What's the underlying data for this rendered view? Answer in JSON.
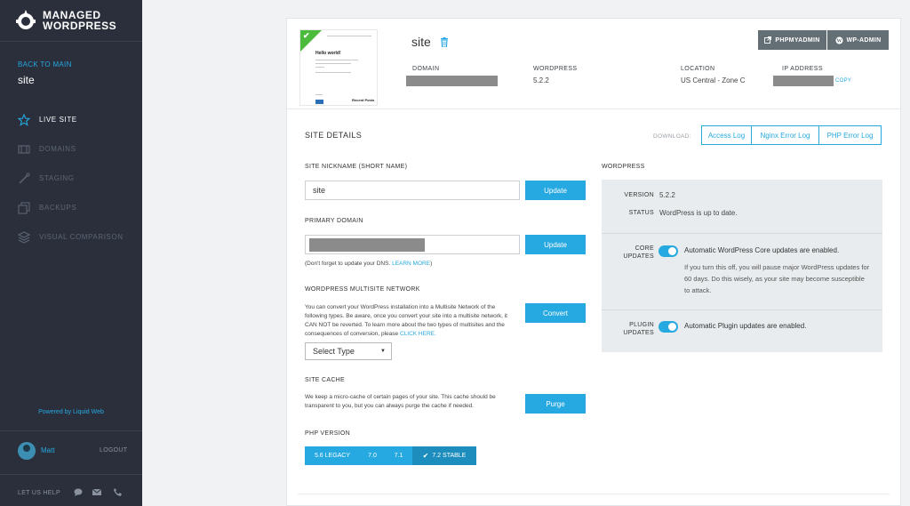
{
  "sidebar": {
    "brand_line1": "MANAGED",
    "brand_line2": "WORDPRESS",
    "back_label": "BACK TO MAIN",
    "site_name": "site",
    "items": [
      {
        "label": "LIVE SITE",
        "icon": "star-icon",
        "active": true
      },
      {
        "label": "DOMAINS",
        "icon": "domains-icon",
        "active": false
      },
      {
        "label": "STAGING",
        "icon": "staging-icon",
        "active": false
      },
      {
        "label": "BACKUPS",
        "icon": "backups-icon",
        "active": false
      },
      {
        "label": "VISUAL COMPARISON",
        "icon": "layers-icon",
        "active": false
      }
    ],
    "powered": "Powered by Liquid Web",
    "user": "Matt",
    "logout": "LOGOUT",
    "help": "LET US HELP"
  },
  "thumb": {
    "title": "Hello world!",
    "posts": "Recent Posts"
  },
  "header": {
    "site_title": "site",
    "domain_label": "DOMAIN",
    "wp_label": "WORDPRESS",
    "wp_version": "5.2.2",
    "location_label": "LOCATION",
    "location_value": "US Central - Zone C",
    "ip_label": "IP ADDRESS",
    "copy": "COPY",
    "phpmyadmin": "PHPMYADMIN",
    "wpadmin": "WP-ADMIN"
  },
  "details": {
    "title": "SITE DETAILS",
    "download_label": "DOWNLOAD:",
    "logs": [
      "Access Log",
      "Nginx Error Log",
      "PHP Error Log"
    ],
    "nickname_label": "SITE NICKNAME (SHORT NAME)",
    "nickname_value": "site",
    "update": "Update",
    "primary_domain_label": "PRIMARY DOMAIN",
    "dns_hint_pre": "(Don't forget to update your DNS.",
    "dns_hint_link": "LEARN MORE",
    "dns_hint_post": ")",
    "multisite_label": "WORDPRESS MULTISITE NETWORK",
    "multisite_text": "You can convert your WordPress installation into a Multisite Network of the following types. Be aware, once you convert your site into a multisite network, it CAN NOT be reverted. To learn more about the two types of multisites and the consequences of conversion, please",
    "multisite_link": "CLICK HERE.",
    "convert": "Convert",
    "select_value": "Select Type",
    "cache_label": "SITE CACHE",
    "cache_text": "We keep a micro-cache of certain pages of your site. This cache should be transparent to you, but you can always purge the cache if needed.",
    "purge": "Purge",
    "php_label": "PHP VERSION",
    "php_versions": [
      {
        "label": "5.6 LEGACY",
        "active": false
      },
      {
        "label": "7.0",
        "active": false
      },
      {
        "label": "7.1",
        "active": false
      },
      {
        "label": "7.2 STABLE",
        "active": true
      }
    ]
  },
  "wordpress": {
    "title": "WORDPRESS",
    "version_label": "VERSION",
    "version_value": "5.2.2",
    "status_label": "STATUS",
    "status_value": "WordPress is up to date.",
    "core_label_1": "CORE",
    "core_label_2": "UPDATES",
    "core_on": true,
    "core_text": "Automatic WordPress Core updates are enabled.",
    "core_note": "If you turn this off, you will pause major WordPress updates for 60 days. Do this wisely, as your site may become susceptible to attack.",
    "plugin_label_1": "PLUGIN",
    "plugin_label_2": "UPDATES",
    "plugin_on": true,
    "plugin_text": "Automatic Plugin updates are enabled."
  },
  "colors": {
    "sidebar_bg": "#2a2f3b",
    "accent": "#26a8e0",
    "header_button": "#646f75",
    "check_green": "#4cba3c"
  }
}
